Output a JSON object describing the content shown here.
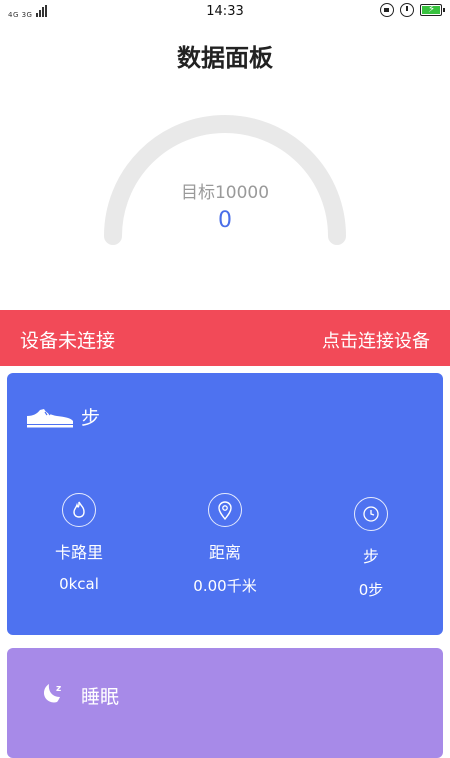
{
  "status_bar": {
    "time": "14:33",
    "signal_text": "4G 3G"
  },
  "page_title": "数据面板",
  "gauge": {
    "goal_label": "目标10000",
    "value": "0",
    "progress_fraction": 0,
    "track_color": "#e9e9e9",
    "value_color": "#4a6ee8"
  },
  "connection": {
    "status": "设备未连接",
    "action": "点击连接设备",
    "color": "#f24a58"
  },
  "steps_card": {
    "title": "步",
    "color": "#4e72f0",
    "icon": "shoe-icon",
    "metrics": [
      {
        "icon": "flame-icon",
        "label": "卡路里",
        "value": "0kcal"
      },
      {
        "icon": "location-pin-icon",
        "label": "距离",
        "value": "0.00千米"
      },
      {
        "icon": "clock-icon",
        "label": "步",
        "value": "0步"
      }
    ]
  },
  "sleep_card": {
    "title": "睡眠",
    "color": "#a78ae8",
    "icon": "moon-icon"
  }
}
